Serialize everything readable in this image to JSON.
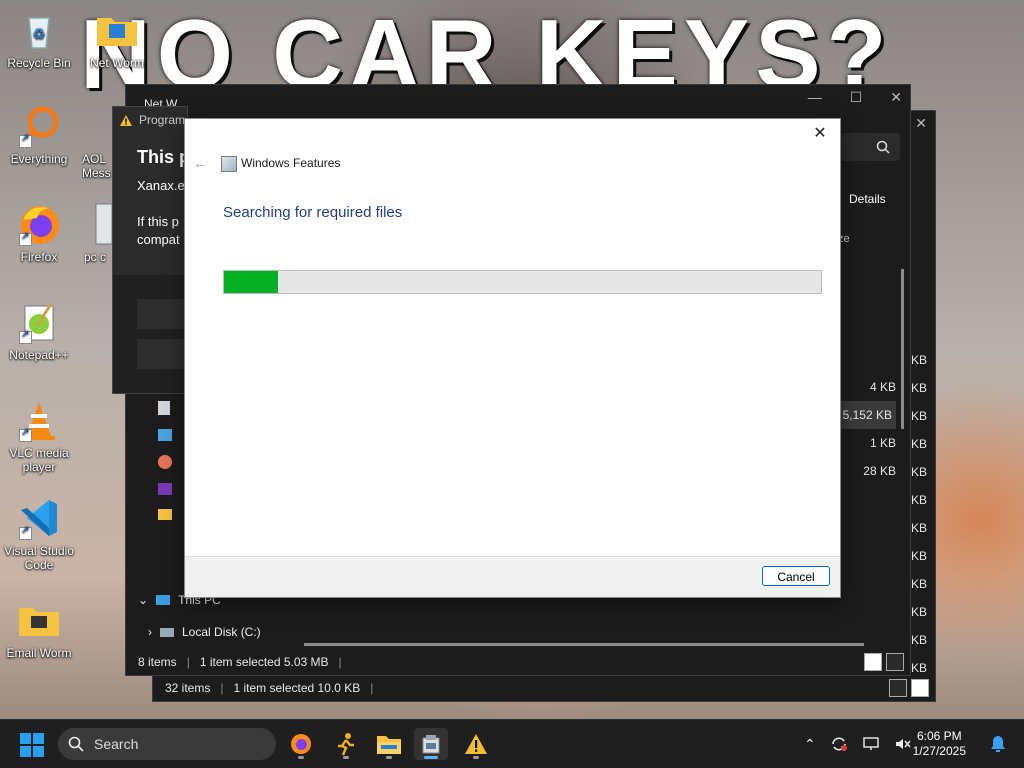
{
  "wallpaper": {
    "meme_text": "NO CAR KEYS?"
  },
  "desktop_icons": [
    {
      "id": "recycle-bin",
      "label": "Recycle Bin"
    },
    {
      "id": "everything",
      "label": "Everything"
    },
    {
      "id": "firefox",
      "label": "Firefox"
    },
    {
      "id": "notepadpp",
      "label": "Notepad++"
    },
    {
      "id": "vlc",
      "label": "VLC media player"
    },
    {
      "id": "vscode",
      "label": "Visual Studio Code"
    },
    {
      "id": "email-worm",
      "label": "Email Worm"
    },
    {
      "id": "net-worm",
      "label": "Net Worm"
    },
    {
      "id": "aol",
      "label": "AOL Mess"
    },
    {
      "id": "pc",
      "label": "pc c"
    }
  ],
  "explorer_back": {
    "status": {
      "items": "32 items",
      "selected": "1 item selected 10.0 KB"
    },
    "sizes": [
      "KB",
      "KB",
      "KB",
      "KB",
      "KB",
      "KB",
      "KB",
      "KB",
      "KB",
      "KB",
      "KB",
      "KB"
    ]
  },
  "explorer_mid": {
    "title": "Net W",
    "details_label": "Details",
    "col_header": "ze",
    "sizes": [
      "4 KB",
      "5,152 KB",
      "1 KB",
      "28 KB"
    ],
    "nav": {
      "this_pc": "This PC",
      "local_disk": "Local Disk (C:)"
    },
    "status": {
      "items": "8 items",
      "selected": "1 item selected 5.03 MB"
    }
  },
  "compat_dialog": {
    "caption": "Program Compatibility Assistant",
    "heading": "This p",
    "exe": "Xanax.e",
    "body_line1": "If this p",
    "body_line2": "compat"
  },
  "windows_features": {
    "title": "Windows Features",
    "heading": "Searching for required files",
    "progress": 0.09,
    "cancel_label": "Cancel",
    "colors": {
      "progress": "#06b025",
      "heading": "#1e3f8a"
    }
  },
  "taskbar": {
    "search_label": "Search",
    "apps": [
      "firefox-icon",
      "runner-icon",
      "file-explorer-icon",
      "windows-features-icon",
      "warning-icon"
    ],
    "time": "6:06 PM",
    "date": "1/27/2025"
  }
}
